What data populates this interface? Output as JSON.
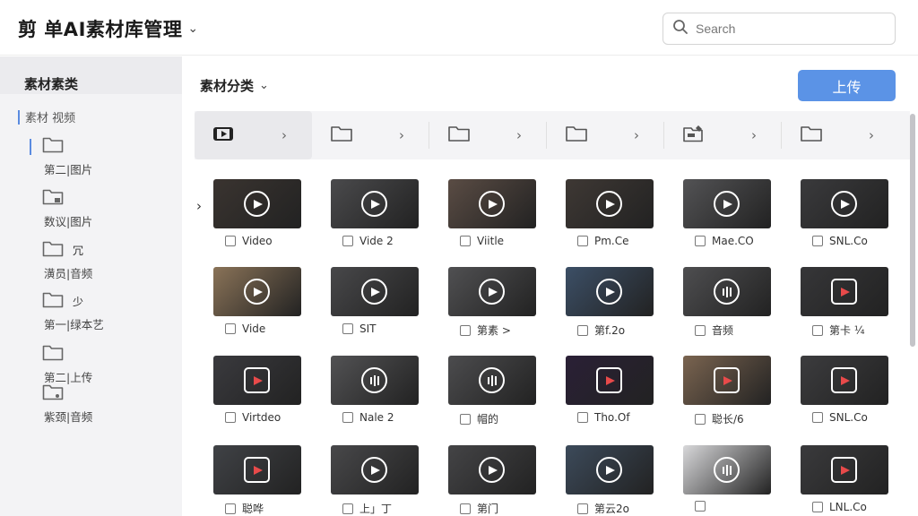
{
  "header": {
    "title": "剪 单AI素材库管理",
    "search_placeholder": "Search"
  },
  "sidebar": {
    "heading": "素材素类",
    "subheading": "素材 视频",
    "items": [
      {
        "label": "第二|图片",
        "icon": "folder-icon"
      },
      {
        "label": "数议|图片",
        "icon": "folder-image-icon"
      },
      {
        "glyph": "冗",
        "label": "潢员|音频",
        "icon": "folder-icon"
      },
      {
        "glyph": "少",
        "label": "第一|绿本艺",
        "icon": "folder-icon"
      },
      {
        "label": "第二|上传",
        "icon": "folder-icon"
      },
      {
        "label": "紫颈|音频",
        "icon": "folder-audio-icon"
      }
    ]
  },
  "main": {
    "category_label": "素材分类",
    "upload_label": "上传",
    "folder_strip": [
      {
        "icon": "video-folder-icon",
        "active": true
      },
      {
        "icon": "folder-icon",
        "active": false
      },
      {
        "icon": "folder-icon",
        "active": false
      },
      {
        "icon": "folder-icon",
        "active": false
      },
      {
        "icon": "folder-edit-icon",
        "active": false
      },
      {
        "icon": "folder-icon",
        "active": false
      }
    ],
    "rows": [
      [
        {
          "label": "Video",
          "bg": "#3a3430",
          "play": "round"
        },
        {
          "label": "Vide 2",
          "bg": "#4a4a4c",
          "play": "round"
        },
        {
          "label": "Viitle",
          "bg": "#5a4c44",
          "play": "round"
        },
        {
          "label": "Pm.Ce",
          "bg": "#3e3834",
          "play": "round"
        },
        {
          "label": "Mae.CO",
          "bg": "#535355",
          "play": "round"
        },
        {
          "label": "SNL.Co",
          "bg": "#3a3a3c",
          "play": "round"
        }
      ],
      [
        {
          "label": "Vide",
          "bg": "#8a7358",
          "play": "round"
        },
        {
          "label": "SIT",
          "bg": "#48484a",
          "play": "round"
        },
        {
          "label": "第素 >",
          "bg": "#505052",
          "play": "round"
        },
        {
          "label": "第f.2o",
          "bg": "#3c4f66",
          "play": "round"
        },
        {
          "label": "音频",
          "bg": "#4e4e50",
          "play": "bars"
        },
        {
          "label": "第卡 ¼",
          "bg": "#363638",
          "play": "red"
        }
      ],
      [
        {
          "label": "Virtdeo",
          "bg": "#3a3a3e",
          "play": "red"
        },
        {
          "label": "Nale 2",
          "bg": "#525254",
          "play": "bars"
        },
        {
          "label": "帽的",
          "bg": "#4c4c4e",
          "play": "bars"
        },
        {
          "label": "Tho.Of",
          "bg": "#2a2036",
          "play": "red"
        },
        {
          "label": "聪长/6",
          "bg": "#7a6450",
          "play": "red"
        },
        {
          "label": "SNL.Co",
          "bg": "#3c3c3e",
          "play": "red"
        }
      ],
      [
        {
          "label": "聪哗",
          "bg": "#404246",
          "play": "red"
        },
        {
          "label": "上」丁",
          "bg": "#48484a",
          "play": "round"
        },
        {
          "label": "第门",
          "bg": "#444446",
          "play": "round"
        },
        {
          "label": "第云2o",
          "bg": "#3c4a5a",
          "play": "round"
        },
        {
          "label": "",
          "bg": "#d8d8da",
          "play": "bars"
        },
        {
          "label": "LNL.Co",
          "bg": "#3a3a3c",
          "play": "red"
        }
      ]
    ]
  }
}
